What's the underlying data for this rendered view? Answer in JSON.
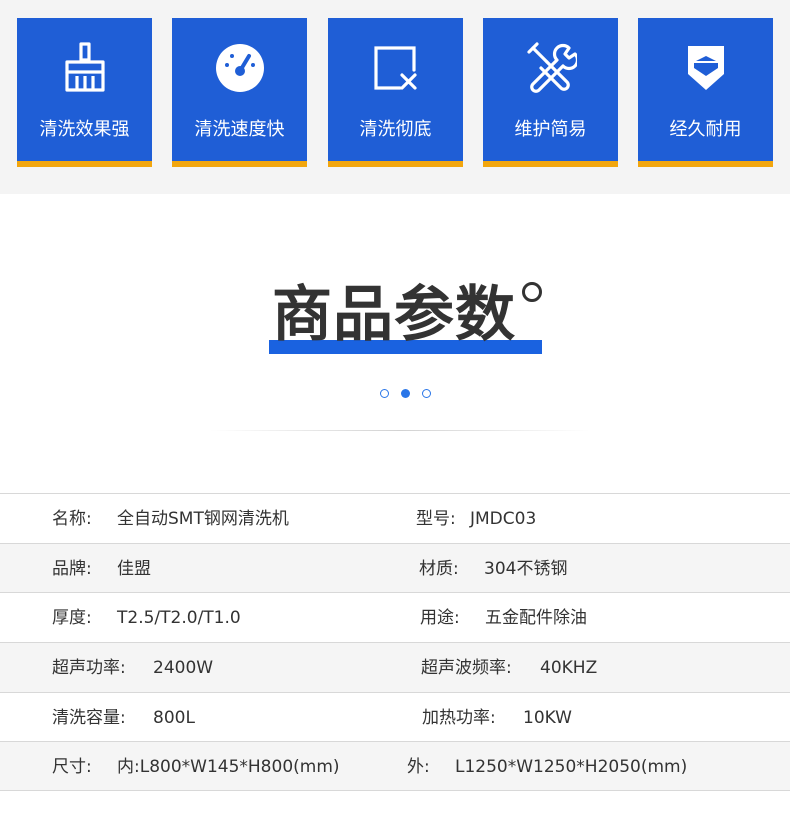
{
  "features": [
    {
      "label": "清洗效果强",
      "icon": "broom-icon"
    },
    {
      "label": "清洗速度快",
      "icon": "speedometer-icon"
    },
    {
      "label": "清洗彻底",
      "icon": "clear-box-icon"
    },
    {
      "label": "维护简易",
      "icon": "tools-icon"
    },
    {
      "label": "经久耐用",
      "icon": "shield-icon"
    }
  ],
  "colors": {
    "card": "#1f5ed6",
    "card_accent": "#f2a60e",
    "title_bar": "#1a62e0"
  },
  "section": {
    "title": "商品参数"
  },
  "specs": [
    {
      "k1": "名称:",
      "v1": "全自动SMT钢网清洗机",
      "k2": "型号:",
      "v2": "JMDC03"
    },
    {
      "k1": "品牌:",
      "v1": "佳盟",
      "k2": "材质:",
      "v2": "304不锈钢"
    },
    {
      "k1": "厚度:",
      "v1": "T2.5/T2.0/T1.0",
      "k2": "用途:",
      "v2": "五金配件除油"
    },
    {
      "k1": "超声功率:",
      "v1": "2400W",
      "k2": "超声波频率:",
      "v2": "40KHZ"
    },
    {
      "k1": "清洗容量:",
      "v1": "800L",
      "k2": "加热功率:",
      "v2": "10KW"
    },
    {
      "k1": "尺寸:",
      "v1": "内:L800*W145*H800(mm)",
      "k2": "外:",
      "v2": "L1250*W1250*H2050(mm)"
    }
  ]
}
